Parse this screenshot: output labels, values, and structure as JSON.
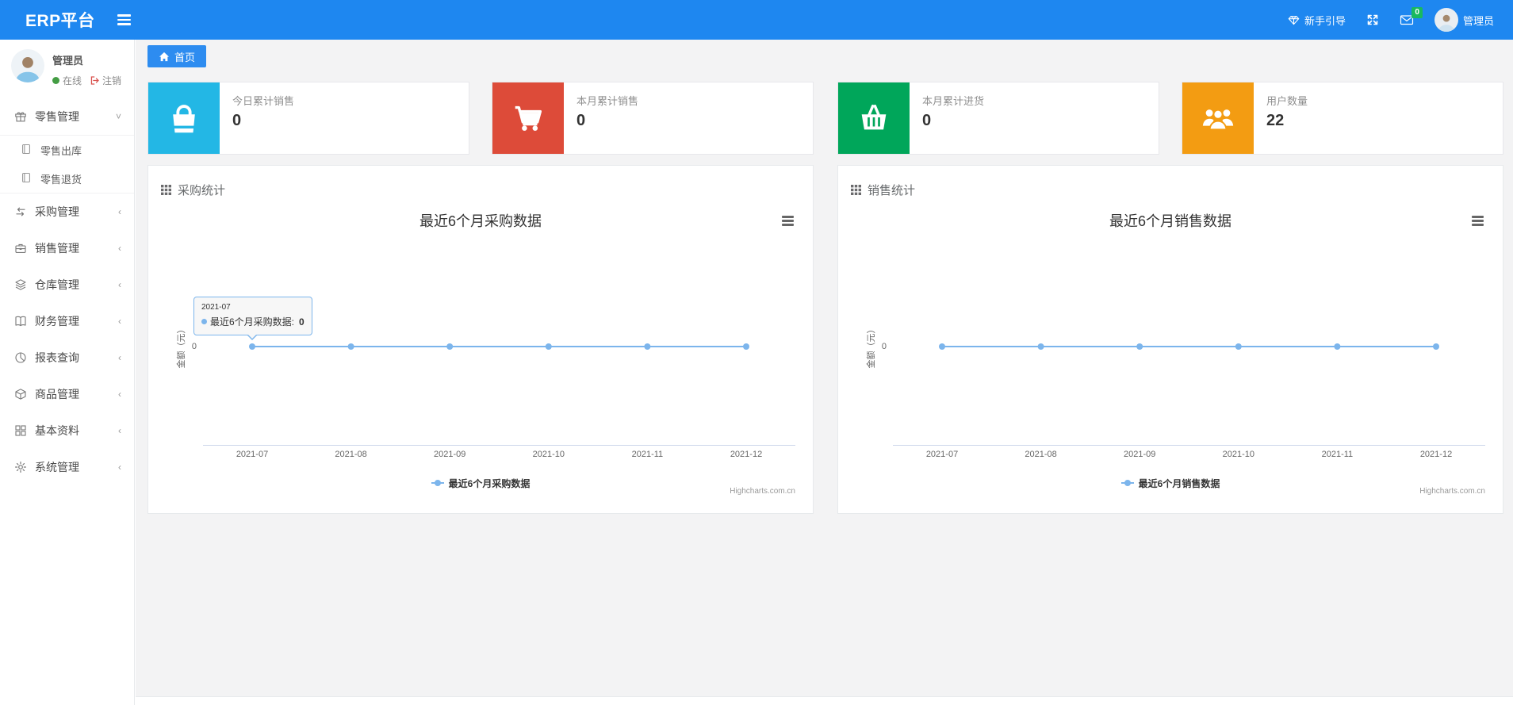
{
  "navbar": {
    "brand": "ERP平台",
    "guide_label": "新手引导",
    "message_badge": "0",
    "username": "管理员",
    "color": "#1e87f0"
  },
  "breadcrumb": {
    "home_label": "首页"
  },
  "sidebar": {
    "user": {
      "name": "管理员",
      "status_label": "在线",
      "logout_label": "注销"
    },
    "items": [
      {
        "label": "零售管理",
        "icon": "gift-icon",
        "expanded": true,
        "children": [
          {
            "label": "零售出库",
            "icon": "file-icon"
          },
          {
            "label": "零售退货",
            "icon": "file-icon"
          }
        ]
      },
      {
        "label": "采购管理",
        "icon": "exchange-icon"
      },
      {
        "label": "销售管理",
        "icon": "briefcase-icon"
      },
      {
        "label": "仓库管理",
        "icon": "layers-icon"
      },
      {
        "label": "财务管理",
        "icon": "book-icon"
      },
      {
        "label": "报表查询",
        "icon": "pie-chart-icon"
      },
      {
        "label": "商品管理",
        "icon": "cube-icon"
      },
      {
        "label": "基本资料",
        "icon": "grid-icon"
      },
      {
        "label": "系统管理",
        "icon": "gear-icon"
      }
    ]
  },
  "stat_cards": [
    {
      "label": "今日累计销售",
      "value": "0",
      "color": "#23b7e5",
      "icon": "shopping-bag-icon"
    },
    {
      "label": "本月累计销售",
      "value": "0",
      "color": "#dd4b39",
      "icon": "cart-icon"
    },
    {
      "label": "本月累计进货",
      "value": "0",
      "color": "#00a65a",
      "icon": "basket-icon"
    },
    {
      "label": "用户数量",
      "value": "22",
      "color": "#f39c12",
      "icon": "users-icon"
    }
  ],
  "chart_data": [
    {
      "type": "line",
      "panel_title": "采购统计",
      "title": "最近6个月采购数据",
      "categories": [
        "2021-07",
        "2021-08",
        "2021-09",
        "2021-10",
        "2021-11",
        "2021-12"
      ],
      "series": [
        {
          "name": "最近6个月采购数据",
          "values": [
            0,
            0,
            0,
            0,
            0,
            0
          ]
        }
      ],
      "ylabel": "金额（元）",
      "yticks": [
        "0"
      ],
      "ylim": [
        0,
        1
      ],
      "grid": false,
      "legend_position": "bottom",
      "line_color": "#7cb5ec",
      "credits": "Highcharts.com.cn",
      "tooltip": {
        "header": "2021-07",
        "series": "最近6个月采购数据:",
        "value": "0"
      }
    },
    {
      "type": "line",
      "panel_title": "销售统计",
      "title": "最近6个月销售数据",
      "categories": [
        "2021-07",
        "2021-08",
        "2021-09",
        "2021-10",
        "2021-11",
        "2021-12"
      ],
      "series": [
        {
          "name": "最近6个月销售数据",
          "values": [
            0,
            0,
            0,
            0,
            0,
            0
          ]
        }
      ],
      "ylabel": "金额（元）",
      "yticks": [
        "0"
      ],
      "ylim": [
        0,
        1
      ],
      "grid": false,
      "legend_position": "bottom",
      "line_color": "#7cb5ec",
      "credits": "Highcharts.com.cn"
    }
  ]
}
